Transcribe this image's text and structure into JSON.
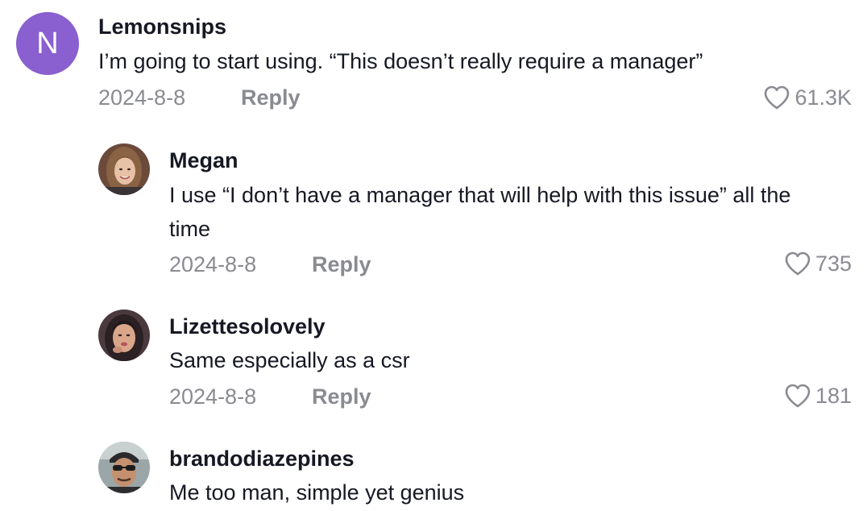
{
  "comments": [
    {
      "username": "Lemonsnips",
      "avatar_letter": "N",
      "avatar_color": "#8a5fd0",
      "text": "I’m going to start using. “This doesn’t really require a manager”",
      "date": "2024-8-8",
      "reply_label": "Reply",
      "likes": "61.3K"
    },
    {
      "username": "Megan",
      "text": "I use “I don’t have a manager that will help with this issue” all the time",
      "date": "2024-8-8",
      "reply_label": "Reply",
      "likes": "735"
    },
    {
      "username": "Lizettesolovely",
      "text": "Same especially as a csr",
      "date": "2024-8-8",
      "reply_label": "Reply",
      "likes": "181"
    },
    {
      "username": "brandodiazepines",
      "text": "Me too man, simple yet genius"
    }
  ],
  "icons": {
    "like": "heart-outline-icon"
  },
  "colors": {
    "meta_text": "#8a8b91",
    "primary_text": "#161823"
  }
}
